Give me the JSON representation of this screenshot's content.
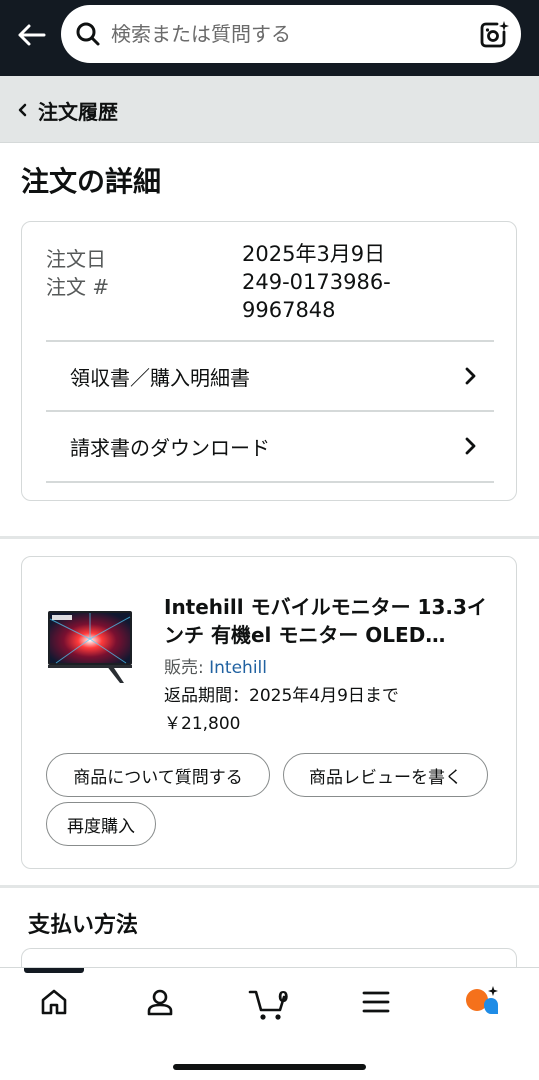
{
  "search": {
    "placeholder": "検索または質問する"
  },
  "breadcrumb": {
    "label": "注文履歴"
  },
  "page": {
    "title": "注文の詳細"
  },
  "order": {
    "date_label": "注文日",
    "date_value": "2025年3月9日",
    "number_label": "注文 #",
    "number_value_line1": "249-0173986-",
    "number_value_line2": "9967848",
    "links": [
      {
        "label": "領収書／購入明細書"
      },
      {
        "label": "請求書のダウンロード"
      }
    ]
  },
  "product": {
    "title": "Intehill モバイルモニター 13.3インチ 有機el モニター OLED…",
    "seller_prefix": "販売: ",
    "seller_name": "Intehill",
    "return_period": "返品期間：2025年4月9日まで",
    "price": "￥21,800",
    "buttons": {
      "ask_question": "商品について質問する",
      "write_review": "商品レビューを書く",
      "buy_again": "再度購入"
    }
  },
  "payment": {
    "title": "支払い方法"
  },
  "nav": {
    "cart_count": "0",
    "items": [
      "home-icon",
      "account-icon",
      "cart-icon",
      "menu-icon",
      "rufus-icon"
    ]
  },
  "colors": {
    "topbar": "#131a22",
    "breadcrumb_bg": "#e3e6e6",
    "link": "#2162a1",
    "rufus_orange": "#f5711b",
    "rufus_blue": "#1f8ce6"
  }
}
